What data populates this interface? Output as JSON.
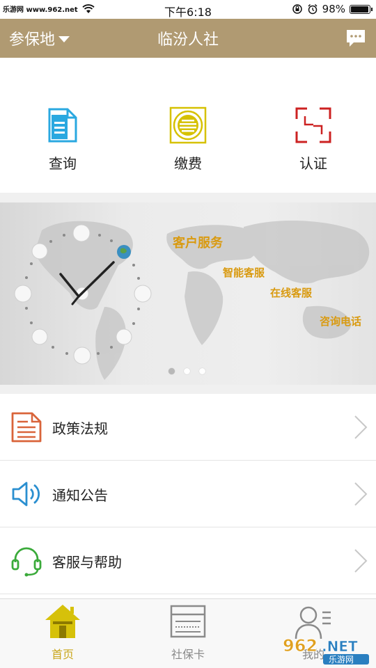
{
  "status_bar": {
    "watermark": "乐游网 www.962.net",
    "time": "下午6:18",
    "battery": "98%",
    "battery_level": 0.98
  },
  "nav": {
    "location": "参保地",
    "title": "临汾人社",
    "message_icon": "chat-bubble-icon"
  },
  "quick_actions": [
    {
      "label": "查询",
      "icon": "document-icon",
      "color": "#2aa8e0"
    },
    {
      "label": "缴费",
      "icon": "payment-coin-icon",
      "color": "#d6c100"
    },
    {
      "label": "认证",
      "icon": "scan-frame-icon",
      "color": "#cc2222"
    }
  ],
  "banner": {
    "title": "客户服务",
    "items": [
      "智能客服",
      "在线客服",
      "咨询电话"
    ],
    "page_count": 3,
    "active_page": 1,
    "accent": "#d99a10"
  },
  "menu": [
    {
      "label": "政策法规",
      "icon": "policy-document-icon",
      "color": "#d9643a"
    },
    {
      "label": "通知公告",
      "icon": "speaker-icon",
      "color": "#2a8fd0"
    },
    {
      "label": "客服与帮助",
      "icon": "headset-icon",
      "color": "#3aaa3a"
    }
  ],
  "tabs": [
    {
      "label": "首页",
      "icon": "home-icon",
      "active": true
    },
    {
      "label": "社保卡",
      "icon": "card-icon",
      "active": false
    },
    {
      "label": "我的",
      "icon": "profile-icon",
      "active": false
    }
  ],
  "watermark_logo": "962.NET 乐游网",
  "colors": {
    "nav_bg": "#b09a72",
    "tab_active": "#c9a61b",
    "tab_inactive": "#888888"
  }
}
